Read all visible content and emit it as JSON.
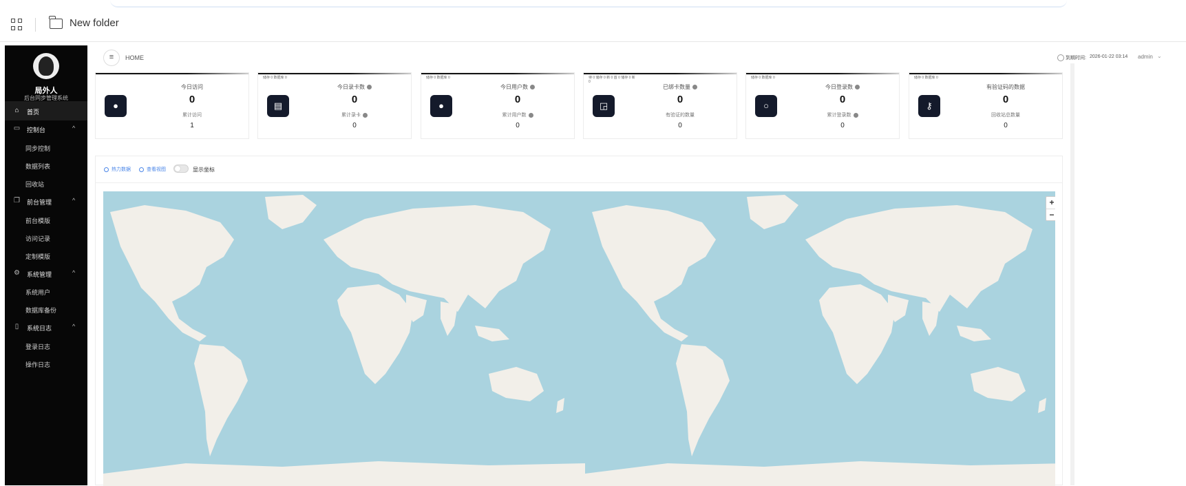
{
  "explorer": {
    "folder_name": "New folder"
  },
  "brand": {
    "name": "局外人",
    "subtitle": "后台同步管理系统"
  },
  "nav": {
    "home": "首页",
    "console": {
      "label": "控制台",
      "items": [
        "同步控制",
        "数据列表",
        "回收站"
      ]
    },
    "frontend": {
      "label": "前台管理",
      "items": [
        "前台模版",
        "访问记录",
        "定制模版"
      ]
    },
    "system": {
      "label": "系统管理",
      "items": [
        "系统用户",
        "数据库备份"
      ]
    },
    "logs": {
      "label": "系统日志",
      "items": [
        "登录日志",
        "操作日志"
      ]
    }
  },
  "header": {
    "breadcrumb": "HOME",
    "expire_label": "到期时间:",
    "expire_value": "2026-01-22 03:14",
    "user": "admin"
  },
  "cards": [
    {
      "title": "今日访问",
      "value": "0",
      "sub_title": "累计访问",
      "sub_value": "1",
      "tiny": ""
    },
    {
      "title": "今日录卡数",
      "value": "0",
      "sub_title": "累计录卡",
      "sub_value": "0",
      "tiny": "储存 0 数据库 0"
    },
    {
      "title": "今日用户数",
      "value": "0",
      "sub_title": "累计用户数",
      "sub_value": "0",
      "tiny": "储存 0 数据库 0"
    },
    {
      "title": "已绑卡数量",
      "value": "0",
      "sub_title": "有验证的数量",
      "sub_value": "0",
      "tiny": "待 0 储存 0 新 0 首 0 储存 0 新 0"
    },
    {
      "title": "今日登录数",
      "value": "0",
      "sub_title": "累计登录数",
      "sub_value": "0",
      "tiny": "储存 0 数据库 0"
    },
    {
      "title": "有验证码的数据",
      "value": "0",
      "sub_title": "回收站总数量",
      "sub_value": "0",
      "tiny": "储存 0 数据库 0"
    }
  ],
  "map": {
    "option_1": "热力数据",
    "option_2": "查看视图",
    "toggle_label": "显示坐标",
    "toggle_on": false,
    "zoom_in": "+",
    "zoom_out": "−",
    "colors": {
      "water": "#aad3df",
      "land": "#f2efe9"
    }
  }
}
